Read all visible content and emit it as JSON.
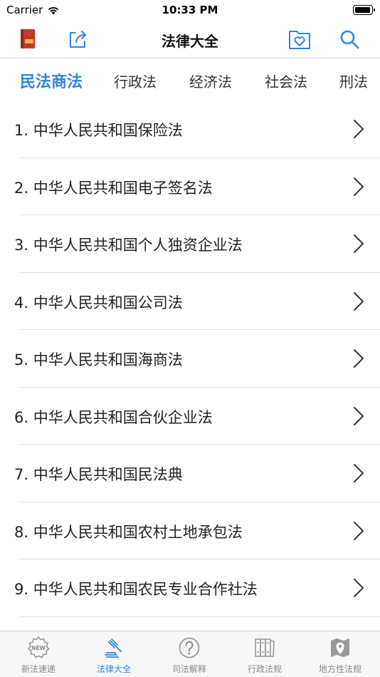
{
  "status_bar": {
    "carrier": "Carrier",
    "time": "10:33 PM"
  },
  "nav": {
    "title": "法律大全",
    "icons": [
      "book-icon",
      "share-icon",
      "favorites-icon",
      "search-icon"
    ]
  },
  "tabs": [
    {
      "label": "民法商法",
      "active": true
    },
    {
      "label": "行政法",
      "active": false
    },
    {
      "label": "经济法",
      "active": false
    },
    {
      "label": "社会法",
      "active": false
    },
    {
      "label": "刑法",
      "active": false
    }
  ],
  "laws": [
    "1. 中华人民共和国保险法",
    "2. 中华人民共和国电子签名法",
    "3. 中华人民共和国个人独资企业法",
    "4. 中华人民共和国公司法",
    "5. 中华人民共和国海商法",
    "6. 中华人民共和国合伙企业法",
    "7. 中华人民共和国民法典",
    "8. 中华人民共和国农村土地承包法",
    "9. 中华人民共和国农民专业合作社法"
  ],
  "tab_bar": [
    {
      "label": "新法速递",
      "icon": "new-badge-icon",
      "active": false
    },
    {
      "label": "法律大全",
      "icon": "gavel-icon",
      "active": true
    },
    {
      "label": "司法解释",
      "icon": "question-icon",
      "active": false
    },
    {
      "label": "行政法规",
      "icon": "books-icon",
      "active": false
    },
    {
      "label": "地方性法规",
      "icon": "map-pin-icon",
      "active": false
    }
  ],
  "colors": {
    "accent": "#2e86de",
    "book": "#c0392b"
  }
}
